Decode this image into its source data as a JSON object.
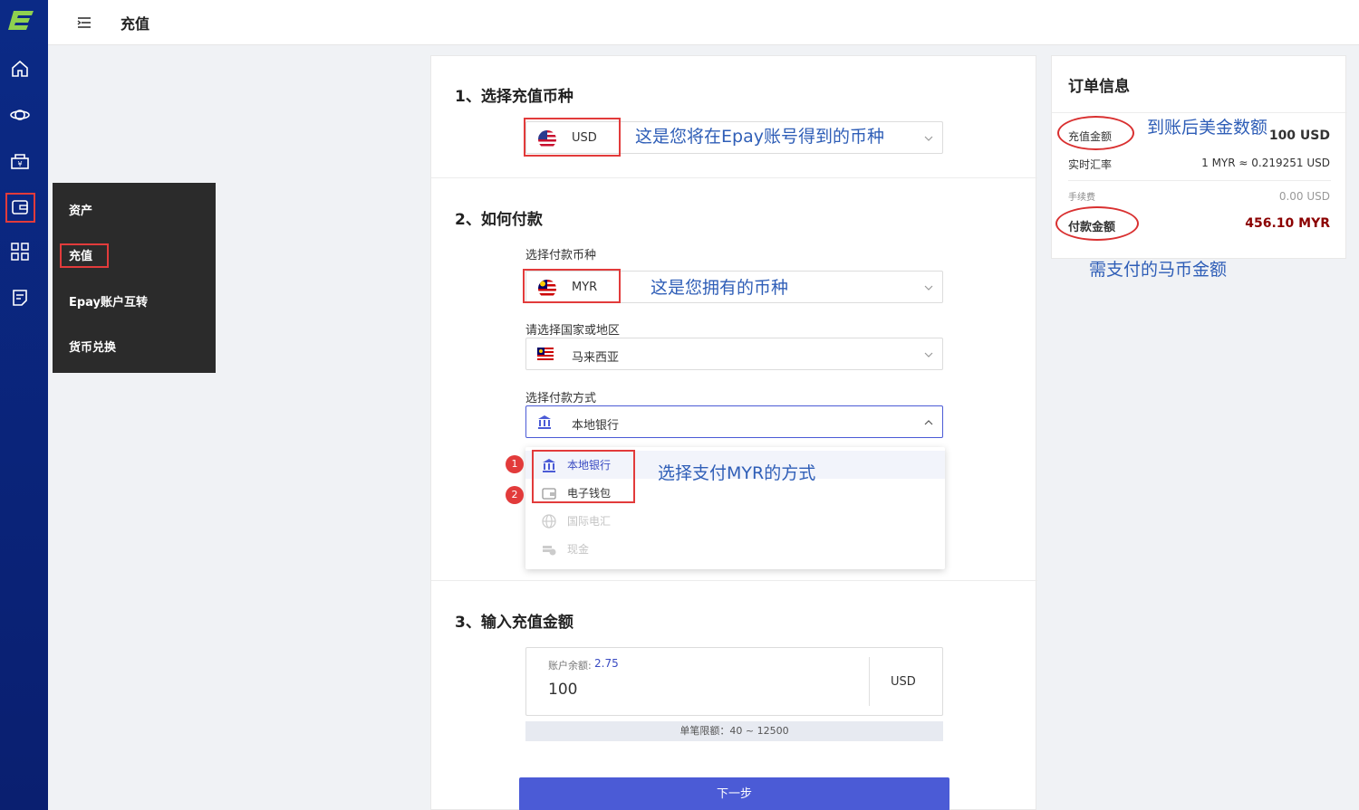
{
  "header": {
    "title": "充值"
  },
  "rail": {
    "icons": [
      "logo-icon",
      "home-icon",
      "planet-icon",
      "yuan-box-icon",
      "wallet-icon",
      "apps-grid-icon",
      "note-icon"
    ]
  },
  "flyout": {
    "items": [
      "资产",
      "充值",
      "Epay账户互转",
      "货币兑换"
    ]
  },
  "sections": {
    "s1_title": "1、选择充值币种",
    "s2_title": "2、如何付款",
    "s3_title": "3、输入充值金额"
  },
  "currency_select": {
    "value": "USD",
    "annotation": "这是您将在Epay账号得到的币种"
  },
  "pay_currency": {
    "label": "选择付款币种",
    "value": "MYR",
    "annotation": "这是您拥有的币种"
  },
  "country": {
    "label": "请选择国家或地区",
    "value": "马来西亚"
  },
  "pay_method": {
    "label": "选择付款方式",
    "value": "本地银行",
    "annotation": "选择支付MYR的方式",
    "options": [
      "本地银行",
      "电子钱包",
      "国际电汇",
      "现金"
    ],
    "badges": [
      "1",
      "2"
    ]
  },
  "amount": {
    "balance_label": "账户余额:",
    "balance_value": "2.75",
    "value": "100",
    "currency": "USD",
    "limit": "单笔限额：40 ~ 12500"
  },
  "next_button": "下一步",
  "order": {
    "title": "订单信息",
    "recharge_label": "充值金额",
    "recharge_value": "100 USD",
    "recharge_annotation": "到账后美金数额",
    "rate_label": "实时汇率",
    "rate_value": "1 MYR ≈ 0.219251 USD",
    "fee_label": "手续费",
    "fee_value": "0.00 USD",
    "pay_label": "付款金额",
    "pay_value": "456.10 MYR",
    "pay_annotation": "需支付的马币金额"
  },
  "colors": {
    "rail": "#0b2a86",
    "accent": "#4b5bd6",
    "annotation": "#2f5eb7",
    "highlight": "#e23b3b",
    "pay_value": "#8b0000"
  }
}
